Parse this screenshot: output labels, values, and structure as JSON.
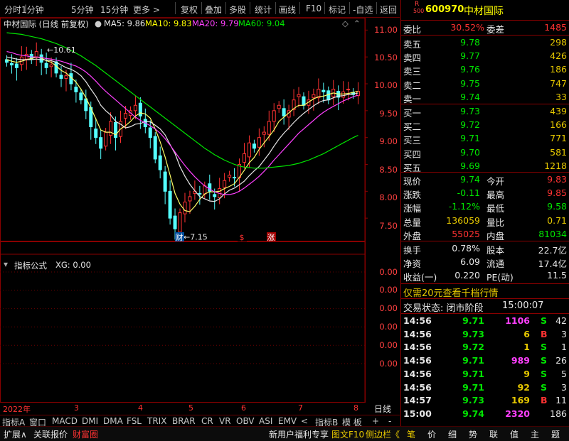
{
  "toolbar": {
    "left": [
      "分时",
      "1分钟",
      "5分钟",
      "15分钟",
      "更多 >"
    ],
    "right": [
      "复权",
      "叠加",
      "多股",
      "统计",
      "画线",
      "F10",
      "标记",
      "-自选",
      "返回"
    ]
  },
  "chart": {
    "legend_title": "中材国际 (日线 前复权)",
    "ma5_label": "MA5: 9.86",
    "ma10_label": "MA10: 9.83",
    "ma20_label": "MA20: 9.79",
    "ma60_label": "MA60: 9.04",
    "high_label": "10.61",
    "low_label": "7.15",
    "markers": [
      "财",
      "$",
      "涨"
    ],
    "y_ticks": [
      "11.00",
      "10.50",
      "10.00",
      "9.50",
      "9.00",
      "8.50",
      "8.00",
      "7.50"
    ],
    "indicator_title": "指标公式",
    "indicator_value": "XG: 0.00",
    "indicator_ticks": [
      "0.00",
      "0.00",
      "0.00",
      "0.00",
      "0.00",
      "0.00"
    ],
    "x_labels": [
      "2022年",
      "3",
      "4",
      "5",
      "6",
      "7",
      "8"
    ],
    "period": "日线"
  },
  "chart_data": {
    "type": "candlestick",
    "ylim": [
      7.0,
      11.15
    ],
    "close": [
      10.4,
      10.35,
      10.3,
      10.5,
      10.55,
      10.45,
      10.6,
      10.4,
      10.3,
      10.35,
      10.2,
      10.1,
      10.15,
      10.0,
      9.85,
      9.7,
      9.5,
      9.2,
      9.0,
      8.8,
      9.1,
      9.3,
      9.0,
      9.3,
      9.45,
      9.5,
      9.6,
      9.4,
      9.2,
      9.0,
      8.6,
      8.4,
      8.0,
      7.5,
      7.3,
      7.6,
      7.8,
      7.9,
      8.0,
      7.95,
      8.1,
      8.0,
      7.9,
      8.05,
      8.2,
      8.3,
      8.25,
      8.5,
      8.7,
      8.9,
      8.8,
      9.0,
      9.1,
      9.3,
      9.5,
      9.6,
      9.4,
      9.5,
      9.7,
      9.8,
      9.6,
      9.7,
      9.8,
      9.9,
      9.85,
      9.7,
      9.9,
      9.75,
      9.85,
      9.9,
      9.8,
      9.86
    ],
    "series": [
      {
        "name": "MA5",
        "color": "#ffff66",
        "values": [
          10.45,
          10.42,
          10.4,
          10.42,
          10.45,
          10.47,
          10.5,
          10.48,
          10.43,
          10.4,
          10.33,
          10.25,
          10.2,
          10.12,
          10.03,
          9.9,
          9.74,
          9.55,
          9.35,
          9.14,
          9.1,
          9.1,
          9.05,
          9.16,
          9.22,
          9.3,
          9.4,
          9.46,
          9.44,
          9.36,
          9.16,
          8.92,
          8.64,
          8.3,
          7.96,
          7.76,
          7.64,
          7.62,
          7.72,
          7.85,
          7.95,
          7.99,
          7.99,
          8.0,
          8.05,
          8.09,
          8.14,
          8.26,
          8.39,
          8.53,
          8.63,
          8.78,
          8.9,
          9.02,
          9.14,
          9.3,
          9.38,
          9.46,
          9.54,
          9.6,
          9.6,
          9.66,
          9.72,
          9.76,
          9.77,
          9.8,
          9.83,
          9.81,
          9.81,
          9.82,
          9.84,
          9.86
        ]
      },
      {
        "name": "MA10",
        "color": "#e6e6e6",
        "values": [
          10.5,
          10.48,
          10.46,
          10.45,
          10.45,
          10.45,
          10.46,
          10.45,
          10.44,
          10.43,
          10.4,
          10.35,
          10.3,
          10.27,
          10.22,
          10.15,
          10.04,
          9.9,
          9.77,
          9.6,
          9.5,
          9.42,
          9.3,
          9.25,
          9.18,
          9.2,
          9.25,
          9.26,
          9.3,
          9.29,
          9.23,
          9.16,
          9.05,
          8.87,
          8.7,
          8.46,
          8.28,
          8.13,
          8.01,
          7.9,
          7.86,
          7.82,
          7.81,
          7.86,
          7.95,
          8.02,
          8.06,
          8.12,
          8.19,
          8.29,
          8.38,
          8.46,
          8.58,
          8.7,
          8.84,
          8.97,
          9.08,
          9.18,
          9.28,
          9.37,
          9.45,
          9.52,
          9.59,
          9.65,
          9.69,
          9.7,
          9.74,
          9.77,
          9.78,
          9.8,
          9.81,
          9.83
        ]
      },
      {
        "name": "MA20",
        "color": "#ff40ff",
        "values": [
          10.6,
          10.58,
          10.55,
          10.53,
          10.52,
          10.5,
          10.5,
          10.49,
          10.47,
          10.46,
          10.44,
          10.42,
          10.39,
          10.36,
          10.33,
          10.28,
          10.22,
          10.14,
          10.05,
          9.95,
          9.86,
          9.78,
          9.7,
          9.62,
          9.54,
          9.46,
          9.38,
          9.32,
          9.27,
          9.22,
          9.16,
          9.08,
          8.98,
          8.86,
          8.73,
          8.6,
          8.48,
          8.37,
          8.27,
          8.18,
          8.1,
          8.04,
          7.99,
          7.96,
          7.94,
          7.94,
          7.96,
          8.0,
          8.06,
          8.13,
          8.2,
          8.28,
          8.37,
          8.47,
          8.58,
          8.68,
          8.78,
          8.88,
          8.98,
          9.08,
          9.16,
          9.24,
          9.32,
          9.4,
          9.47,
          9.53,
          9.58,
          9.63,
          9.68,
          9.72,
          9.76,
          9.79
        ]
      },
      {
        "name": "MA60",
        "color": "#00e600",
        "values": [
          10.95,
          10.94,
          10.93,
          10.92,
          10.9,
          10.88,
          10.86,
          10.84,
          10.81,
          10.78,
          10.75,
          10.71,
          10.67,
          10.62,
          10.57,
          10.52,
          10.46,
          10.4,
          10.34,
          10.27,
          10.2,
          10.13,
          10.06,
          9.99,
          9.92,
          9.85,
          9.78,
          9.71,
          9.64,
          9.57,
          9.5,
          9.43,
          9.36,
          9.29,
          9.22,
          9.15,
          9.08,
          9.01,
          8.94,
          8.87,
          8.8,
          8.74,
          8.68,
          8.63,
          8.58,
          8.54,
          8.5,
          8.47,
          8.45,
          8.44,
          8.43,
          8.43,
          8.43,
          8.44,
          8.45,
          8.46,
          8.47,
          8.48,
          8.5,
          8.52,
          8.55,
          8.58,
          8.62,
          8.66,
          8.7,
          8.75,
          8.8,
          8.85,
          8.9,
          8.95,
          9.0,
          9.04
        ]
      }
    ]
  },
  "panel": {
    "code": "600970",
    "name": "中材国际",
    "rbadge": "R",
    "subbadge": "500",
    "weibi_label": "委比",
    "weibi": "30.52%",
    "weicha_label": "委差",
    "weicha": "1485",
    "asks": [
      {
        "label": "卖五",
        "price": "9.78",
        "vol": "298"
      },
      {
        "label": "卖四",
        "price": "9.77",
        "vol": "426"
      },
      {
        "label": "卖三",
        "price": "9.76",
        "vol": "186"
      },
      {
        "label": "卖二",
        "price": "9.75",
        "vol": "747"
      },
      {
        "label": "卖一",
        "price": "9.74",
        "vol": "33"
      }
    ],
    "bids": [
      {
        "label": "买一",
        "price": "9.73",
        "vol": "439"
      },
      {
        "label": "买二",
        "price": "9.72",
        "vol": "166"
      },
      {
        "label": "买三",
        "price": "9.71",
        "vol": "771"
      },
      {
        "label": "买四",
        "price": "9.70",
        "vol": "581"
      },
      {
        "label": "买五",
        "price": "9.69",
        "vol": "1218"
      }
    ],
    "stats": [
      {
        "l1": "现价",
        "v1": "9.74",
        "c1": "green",
        "l2": "今开",
        "v2": "9.83",
        "c2": "red"
      },
      {
        "l1": "涨跌",
        "v1": "-0.11",
        "c1": "green",
        "l2": "最高",
        "v2": "9.85",
        "c2": "red"
      },
      {
        "l1": "涨幅",
        "v1": "-1.12%",
        "c1": "green",
        "l2": "最低",
        "v2": "9.58",
        "c2": "green"
      },
      {
        "l1": "总量",
        "v1": "136059",
        "c1": "olive",
        "l2": "量比",
        "v2": "0.71",
        "c2": "olive"
      },
      {
        "l1": "外盘",
        "v1": "55025",
        "c1": "red",
        "l2": "内盘",
        "v2": "81034",
        "c2": "green"
      }
    ],
    "fin": [
      {
        "l1": "换手",
        "v1": "0.78%",
        "l2": "股本",
        "v2": "22.7亿"
      },
      {
        "l1": "净资",
        "v1": "6.09",
        "l2": "流通",
        "v2": "17.4亿"
      },
      {
        "l1": "收益(一)",
        "v1": "0.220",
        "l2": "PE(动)",
        "v2": "11.5"
      }
    ],
    "promo": "仅需20元查看千档行情",
    "status_label": "交易状态: 闭市阶段",
    "status_time": "15:00:07",
    "ticks": [
      {
        "t": "14:56",
        "p": "9.71",
        "v": "1106",
        "vc": "magenta",
        "bs": "S",
        "n": "42"
      },
      {
        "t": "14:56",
        "p": "9.73",
        "v": "6",
        "vc": "olive",
        "bs": "B",
        "n": "3"
      },
      {
        "t": "14:56",
        "p": "9.72",
        "v": "1",
        "vc": "olive",
        "bs": "S",
        "n": "1"
      },
      {
        "t": "14:56",
        "p": "9.71",
        "v": "989",
        "vc": "magenta",
        "bs": "S",
        "n": "26"
      },
      {
        "t": "14:56",
        "p": "9.71",
        "v": "9",
        "vc": "olive",
        "bs": "S",
        "n": "5"
      },
      {
        "t": "14:56",
        "p": "9.71",
        "v": "92",
        "vc": "olive",
        "bs": "S",
        "n": "3"
      },
      {
        "t": "14:57",
        "p": "9.73",
        "v": "169",
        "vc": "olive",
        "bs": "B",
        "n": "11"
      },
      {
        "t": "15:00",
        "p": "9.74",
        "v": "2320",
        "vc": "magenta",
        "bs": "",
        "n": "186"
      }
    ]
  },
  "tabs": [
    "指标A",
    "窗口",
    "MACD",
    "DMI",
    "DMA",
    "FSL",
    "TRIX",
    "BRAR",
    "CR",
    "VR",
    "OBV",
    "ASI",
    "EMV",
    "<",
    "指标B",
    "模 板",
    "+",
    "-"
  ],
  "footer": {
    "left": [
      "扩展∧",
      "关联报价",
      "财富圈"
    ],
    "mid": [
      "新用户福利专享",
      "图文F10",
      "侧边栏《"
    ],
    "right": [
      "笔",
      "价",
      "细",
      "势",
      "联",
      "值",
      "主",
      "题"
    ]
  }
}
